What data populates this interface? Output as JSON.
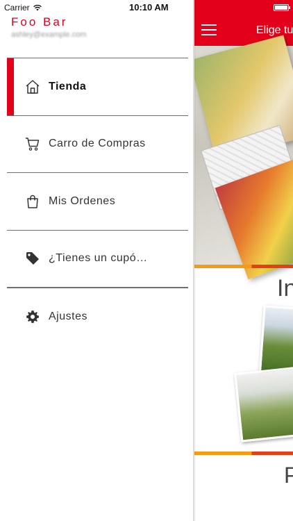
{
  "status_bar": {
    "carrier": "Carrier",
    "time": "10:10 AM"
  },
  "drawer": {
    "user_name": "Foo Bar",
    "user_email": "ashley@example.com",
    "menu_items": [
      {
        "label": "Tienda",
        "icon": "store-icon",
        "active": true
      },
      {
        "label": "Carro de Compras",
        "icon": "cart-icon",
        "active": false
      },
      {
        "label": "Mis Ordenes",
        "icon": "shopping-bag-icon",
        "active": false
      },
      {
        "label": "¿Tienes un cupó…",
        "icon": "tag-icon",
        "active": false
      },
      {
        "label": "Ajustes",
        "icon": "gear-icon",
        "active": false
      }
    ]
  },
  "main": {
    "appbar_title": "Elige tu",
    "card_1_title": "In",
    "card_2_title": "P"
  },
  "colors": {
    "brand_red": "#e2001a",
    "accent_orange": "#f49b13",
    "accent_red_orange": "#e2401a"
  }
}
